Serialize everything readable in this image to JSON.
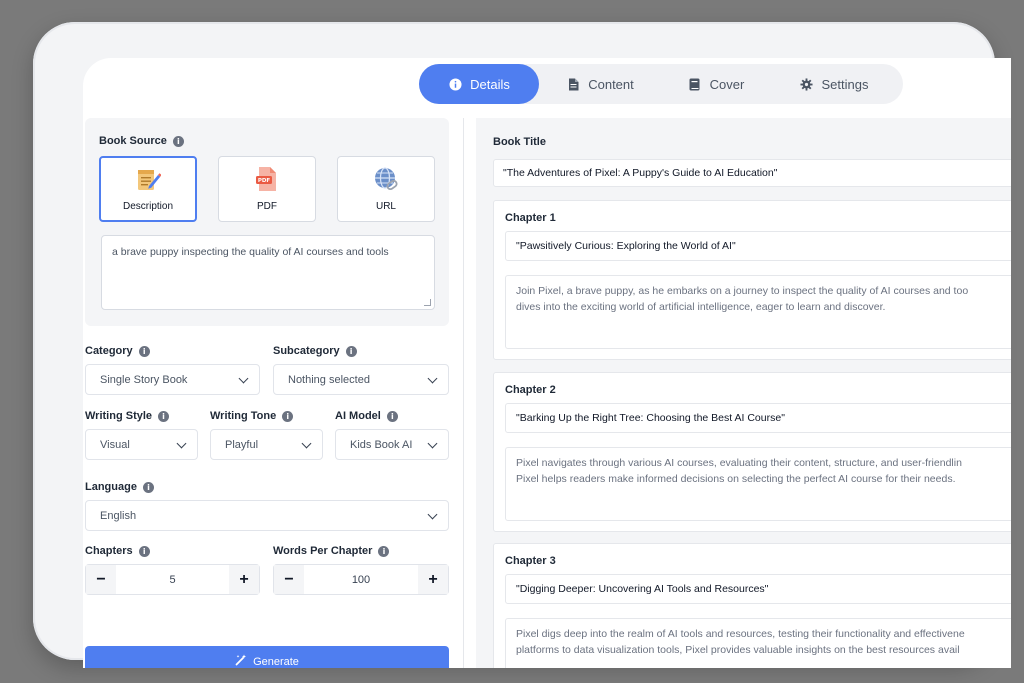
{
  "tabs": [
    {
      "label": "Details",
      "icon": "info-icon",
      "active": true
    },
    {
      "label": "Content",
      "icon": "document-icon",
      "active": false
    },
    {
      "label": "Cover",
      "icon": "book-icon",
      "active": false
    },
    {
      "label": "Settings",
      "icon": "gear-icon",
      "active": false
    }
  ],
  "book_source": {
    "label": "Book Source",
    "options": [
      {
        "label": "Description",
        "icon": "notepad-pencil-icon",
        "selected": true
      },
      {
        "label": "PDF",
        "icon": "pdf-file-icon",
        "selected": false
      },
      {
        "label": "URL",
        "icon": "globe-link-icon",
        "selected": false
      }
    ],
    "description": "a brave puppy inspecting the quality of AI courses and tools"
  },
  "category": {
    "label": "Category",
    "value": "Single Story Book"
  },
  "subcategory": {
    "label": "Subcategory",
    "value": "Nothing selected"
  },
  "writing_style": {
    "label": "Writing Style",
    "value": "Visual"
  },
  "writing_tone": {
    "label": "Writing Tone",
    "value": "Playful"
  },
  "ai_model": {
    "label": "AI Model",
    "value": "Kids Book AI"
  },
  "language": {
    "label": "Language",
    "value": "English"
  },
  "chapters": {
    "label": "Chapters",
    "value": "5",
    "minus": "−",
    "plus": "+"
  },
  "words_per_chapter": {
    "label": "Words Per Chapter",
    "value": "100",
    "minus": "−",
    "plus": "+"
  },
  "generate_label": "Generate",
  "info_glyph": "i",
  "right": {
    "book_title_label": "Book Title",
    "book_title": "\"The Adventures of Pixel: A Puppy's Guide to AI Education\"",
    "chapters": [
      {
        "label": "Chapter 1",
        "title": "\"Pawsitively Curious: Exploring the World of AI\"",
        "body_line1": "Join Pixel, a brave puppy, as he embarks on a journey to inspect the quality of AI courses and too",
        "body_line2": "dives into the exciting world of artificial intelligence, eager to learn and discover."
      },
      {
        "label": "Chapter 2",
        "title": "\"Barking Up the Right Tree: Choosing the Best AI Course\"",
        "body_line1": "Pixel navigates through various AI courses, evaluating their content, structure, and user-friendlin",
        "body_line2": "Pixel helps readers make informed decisions on selecting the perfect AI course for their needs."
      },
      {
        "label": "Chapter 3",
        "title": "\"Digging Deeper: Uncovering AI Tools and Resources\"",
        "body_line1": "Pixel digs deep into the realm of AI tools and resources, testing their functionality and effectivene",
        "body_line2": "platforms to data visualization tools, Pixel provides valuable insights on the best resources avail"
      }
    ]
  },
  "colors": {
    "accent": "#4f7ef0",
    "frame": "#f3f4f6",
    "backdrop": "#7a7a7a"
  }
}
